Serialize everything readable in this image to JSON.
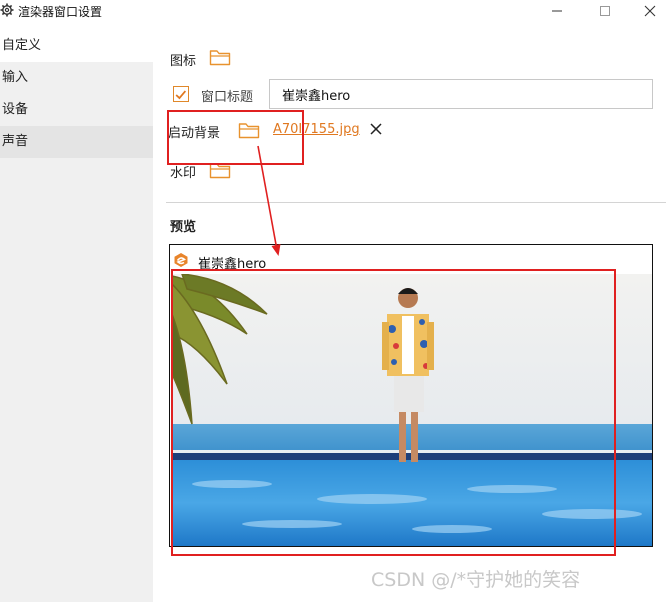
{
  "window": {
    "title": "渲染器窗口设置"
  },
  "sidebar": {
    "items": [
      {
        "label": "自定义"
      },
      {
        "label": "输入"
      },
      {
        "label": "设备"
      },
      {
        "label": "声音"
      }
    ]
  },
  "settings": {
    "icon_label": "图标",
    "window_title_label": "窗口标题",
    "window_title_checked": true,
    "window_title_value": "崔崇鑫hero",
    "startup_bg_label": "启动背景",
    "startup_bg_file": "A70I7155.jpg",
    "watermark_label": "水印"
  },
  "preview": {
    "label": "预览",
    "window_title": "崔崇鑫hero"
  },
  "colors": {
    "accent": "#e07820",
    "annotation": "#e02020"
  },
  "footer_watermark": "CSDN @/*守护她的笑容"
}
